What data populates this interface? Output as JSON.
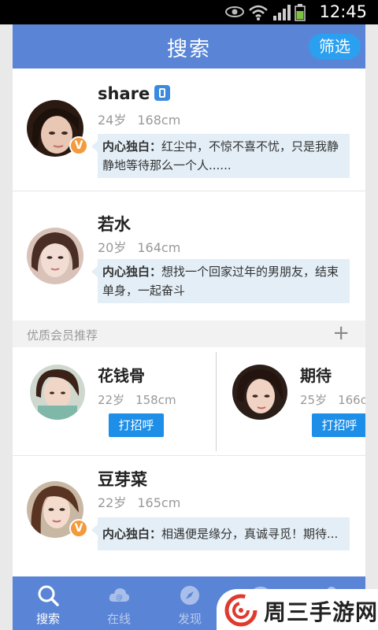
{
  "status_bar": {
    "time": "12:45"
  },
  "header": {
    "title": "搜索",
    "filter_label": "筛选"
  },
  "users": [
    {
      "name": "share",
      "age": "24岁",
      "height": "168cm",
      "monologue_label": "内心独白：",
      "monologue": "红尘中，不惊不喜不忧，只是我静静地等待那么一个人......",
      "vip": "V",
      "phone_verified": true
    },
    {
      "name": "若水",
      "age": "20岁",
      "height": "164cm",
      "monologue_label": "内心独白：",
      "monologue": "想找一个回家过年的男朋友，结束单身，一起奋斗"
    },
    {
      "name": "豆芽菜",
      "age": "22岁",
      "height": "165cm",
      "monologue_label": "内心独白：",
      "monologue": "相遇便是缘分，真诚寻觅！期待...",
      "vip": "V"
    }
  ],
  "recommend": {
    "title": "优质会员推荐",
    "add_symbol": "+",
    "members": [
      {
        "name": "花钱骨",
        "age": "22岁",
        "height": "158cm",
        "button": "打招呼"
      },
      {
        "name": "期待",
        "age": "25岁",
        "height": "166c",
        "button": "打招呼"
      }
    ]
  },
  "nav": [
    {
      "label": "搜索",
      "icon": "search-icon",
      "active": true
    },
    {
      "label": "在线",
      "icon": "cloud-icon",
      "active": false
    },
    {
      "label": "发现",
      "icon": "compass-icon",
      "active": false
    },
    {
      "label": "",
      "icon": "chat-icon",
      "active": false
    },
    {
      "label": "",
      "icon": "user-icon",
      "active": false
    }
  ],
  "watermark": {
    "text": "周三手游网"
  },
  "colors": {
    "header": "#5a85d6",
    "accent": "#2ba0f0",
    "button": "#1e8fe8",
    "vip_badge": "#f39a3c",
    "bubble": "#e3eef6"
  }
}
